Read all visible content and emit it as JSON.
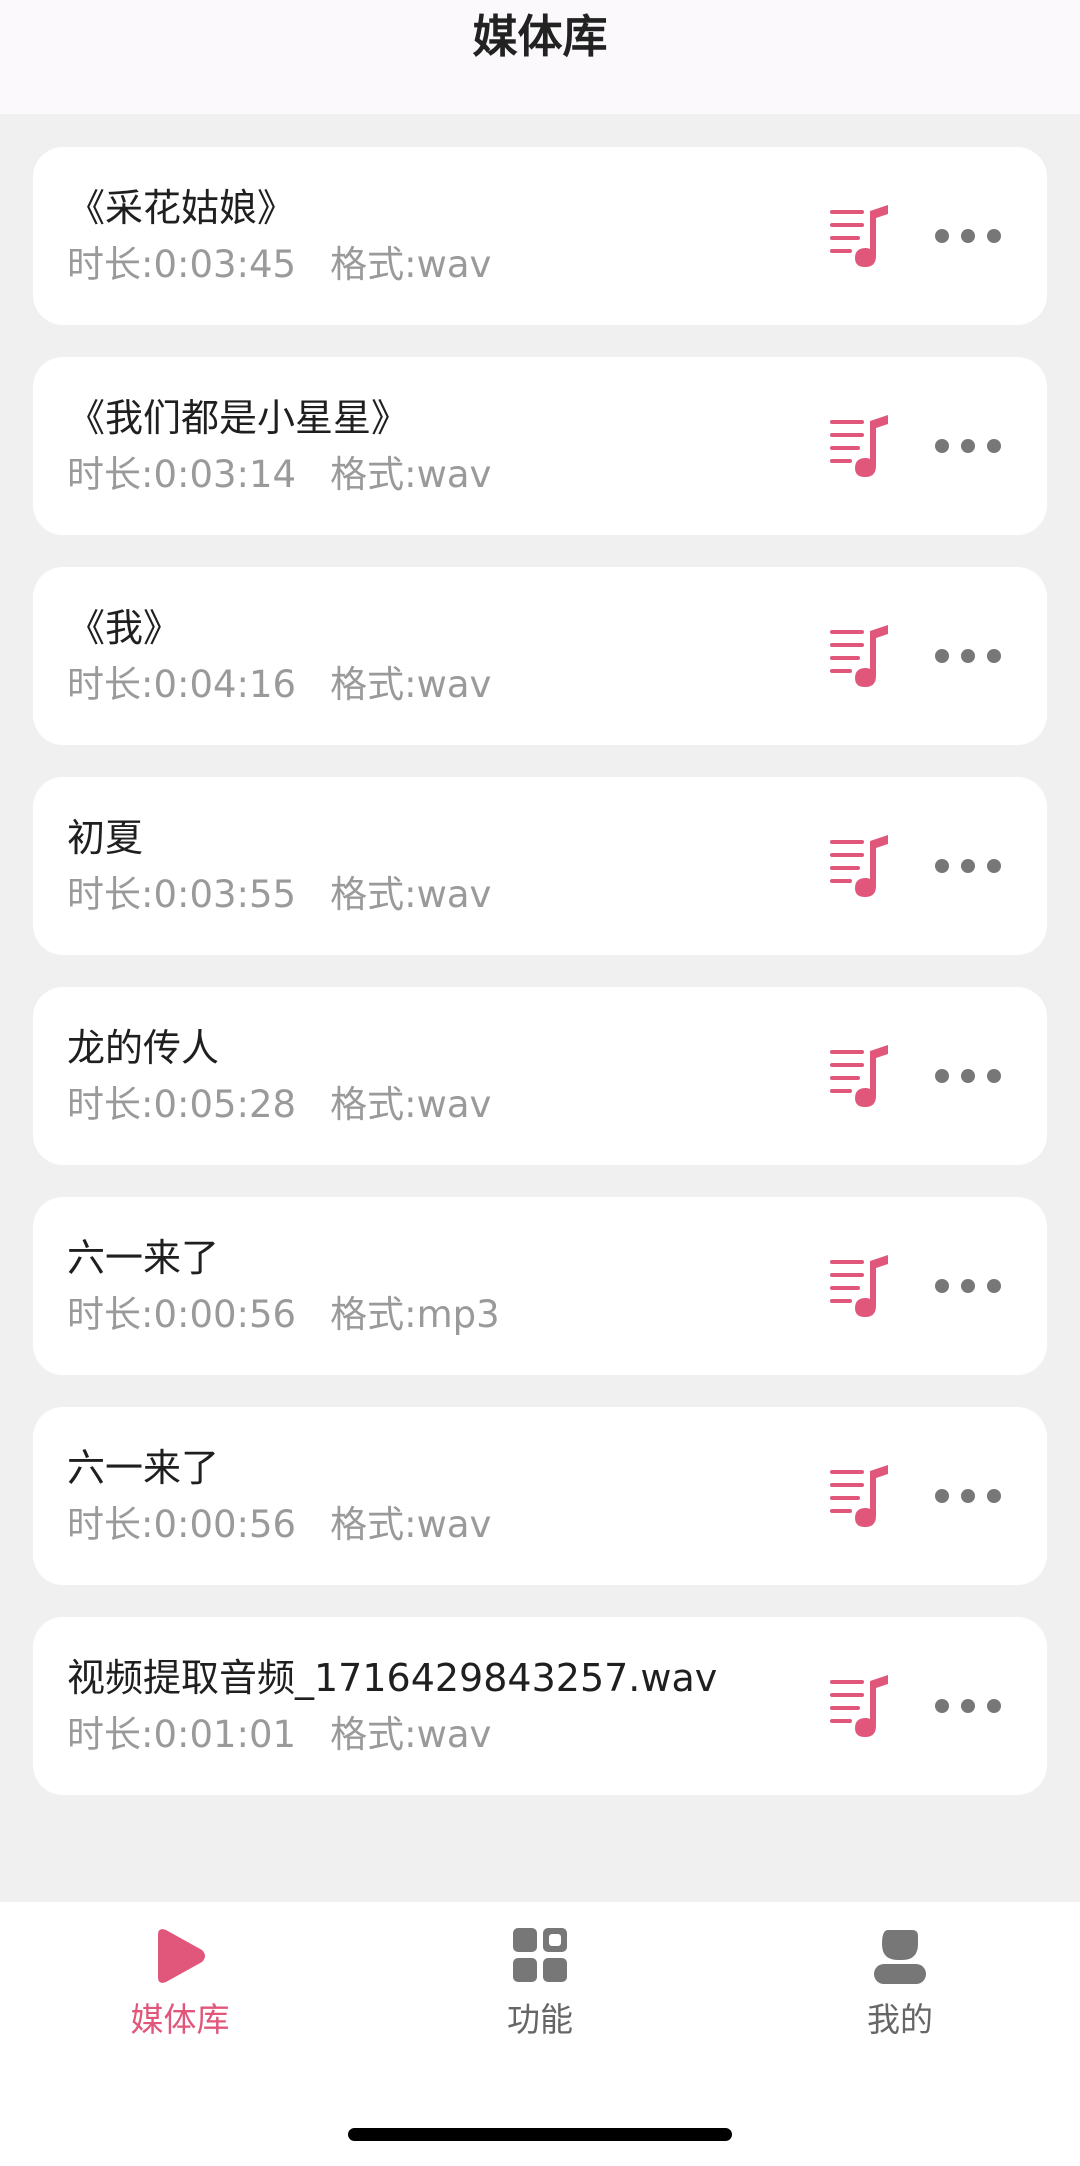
{
  "header": {
    "title": "媒体库"
  },
  "theme": {
    "accent": "#e0577b",
    "text_primary": "#1f1f1f",
    "text_secondary": "#9a9a9a",
    "icon_gray": "#777777",
    "background": "#f0f0f0"
  },
  "list": {
    "items": [
      {
        "title": "《采花姑娘》",
        "duration": "时长:0:03:45",
        "format": "格式:wav"
      },
      {
        "title": "《我们都是小星星》",
        "duration": "时长:0:03:14",
        "format": "格式:wav"
      },
      {
        "title": "《我》",
        "duration": "时长:0:04:16",
        "format": "格式:wav"
      },
      {
        "title": "初夏",
        "duration": "时长:0:03:55",
        "format": "格式:wav"
      },
      {
        "title": "龙的传人",
        "duration": "时长:0:05:28",
        "format": "格式:wav"
      },
      {
        "title": "六一来了",
        "duration": "时长:0:00:56",
        "format": "格式:mp3"
      },
      {
        "title": "六一来了",
        "duration": "时长:0:00:56",
        "format": "格式:wav"
      },
      {
        "title": "视频提取音频_1716429843257.wav",
        "duration": "时长:0:01:01",
        "format": "格式:wav"
      }
    ],
    "item_icons": {
      "playlist": "music-playlist-icon",
      "more": "more-dots-icon"
    }
  },
  "tabbar": {
    "tabs": [
      {
        "label": "媒体库",
        "icon": "play-icon",
        "active": true
      },
      {
        "label": "功能",
        "icon": "grid-icon",
        "active": false
      },
      {
        "label": "我的",
        "icon": "user-icon",
        "active": false
      }
    ]
  }
}
